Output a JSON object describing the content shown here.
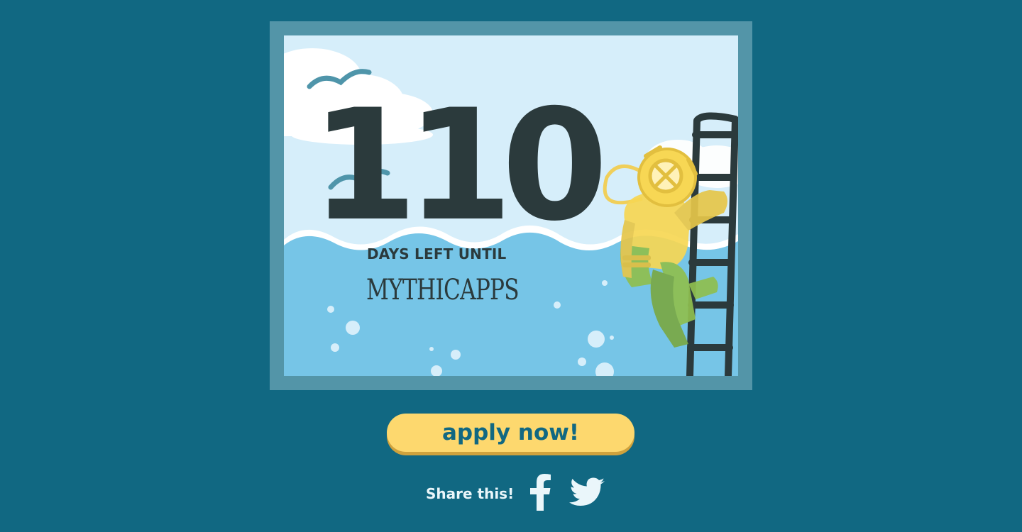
{
  "countdown": {
    "days": "110",
    "label": "DAYS LEFT UNTIL",
    "event": "MYTHICAPPS"
  },
  "cta": {
    "label": "apply now!"
  },
  "share": {
    "label": "Share this!",
    "icons": [
      "facebook-icon",
      "twitter-icon"
    ]
  },
  "colors": {
    "background": "#116882",
    "frame": "#5395a8",
    "sky": "#d6eefa",
    "water": "#76c5e7",
    "text_dark": "#2b3a3c",
    "button": "#fdd86e",
    "button_shadow": "#cfa23d",
    "diver_yellow": "#f7d754",
    "diver_green": "#8fbf4f"
  }
}
